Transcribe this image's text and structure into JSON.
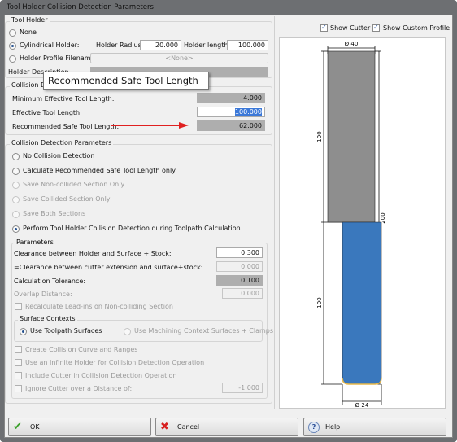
{
  "window": {
    "title": "Tool Holder Collision Detection Parameters"
  },
  "tool_holder": {
    "group_label": "Tool Holder",
    "none_label": "None",
    "cylindrical_label": "Cylindrical Holder:",
    "holder_radius_label": "Holder Radius:",
    "holder_radius": "20.000",
    "holder_length_label": "Holder length:",
    "holder_length": "100.000",
    "profile_label": "Holder Profile Filename",
    "profile_value": "<None>",
    "description_label": "Holder Description",
    "selected": "cylindrical"
  },
  "tooltip": {
    "text": "Recommended Safe Tool Length"
  },
  "collision_lengths": {
    "group_label": "Collision Detection",
    "min_label": "Minimum Effective Tool Length:",
    "min_value": "4.000",
    "effective_label": "Effective Tool Length",
    "effective_value": "100.000",
    "recommended_label": "Recommended Safe Tool Length:",
    "recommended_value": "62.000",
    "arrow_color": "#e02020"
  },
  "params": {
    "group_label": "Collision Detection Parameters",
    "options": [
      {
        "label": "No Collision Detection",
        "enabled": true
      },
      {
        "label": "Calculate Recommended Safe Tool Length only",
        "enabled": true
      },
      {
        "label": "Save Non-collided Section Only",
        "enabled": false
      },
      {
        "label": "Save Collided Section Only",
        "enabled": false
      },
      {
        "label": "Save Both Sections",
        "enabled": false
      },
      {
        "label": "Perform Tool Holder Collision Detection during Toolpath Calculation",
        "enabled": true,
        "selected": true
      }
    ],
    "sub_label": "Parameters",
    "clearance_label": "Clearance between Holder and Surface + Stock:",
    "clearance_value": "0.300",
    "ext_clearance_label": "=Clearance between cutter extension and surface+stock:",
    "ext_clearance_value": "0.000",
    "tolerance_label": "Calculation Tolerance:",
    "tolerance_value": "0.100",
    "overlap_label": "Overlap Distance:",
    "overlap_value": "0.000",
    "recalc_label": "Recalculate Lead-ins on Non-colliding Section",
    "surface_contexts_label": "Surface Contexts",
    "use_toolpath_label": "Use Toolpath Surfaces",
    "use_machining_label": "Use Machining Context Surfaces + Clamps",
    "create_curve_label": "Create Collision Curve and Ranges",
    "infinite_holder_label": "Use an Infinite Holder for Collision Detection Operation",
    "include_cutter_label": "Include Cutter in Collision Detection Operation",
    "ignore_cutter_label": "Ignore Cutter over a Distance of:",
    "ignore_cutter_value": "-1.000"
  },
  "preview": {
    "show_cutter_label": "Show Cutter",
    "show_cutter": true,
    "show_profile_label": "Show Custom Profile",
    "show_profile": true,
    "holder_diameter": "Ø 40",
    "cutter_diameter": "Ø 24",
    "holder_length_dim": "100",
    "cutter_length_dim": "100",
    "total_length_dim": "200",
    "holder_color": "#8e8e8e",
    "cutter_color": "#3a78bd"
  },
  "buttons": {
    "ok": "OK",
    "cancel": "Cancel",
    "help": "Help"
  }
}
